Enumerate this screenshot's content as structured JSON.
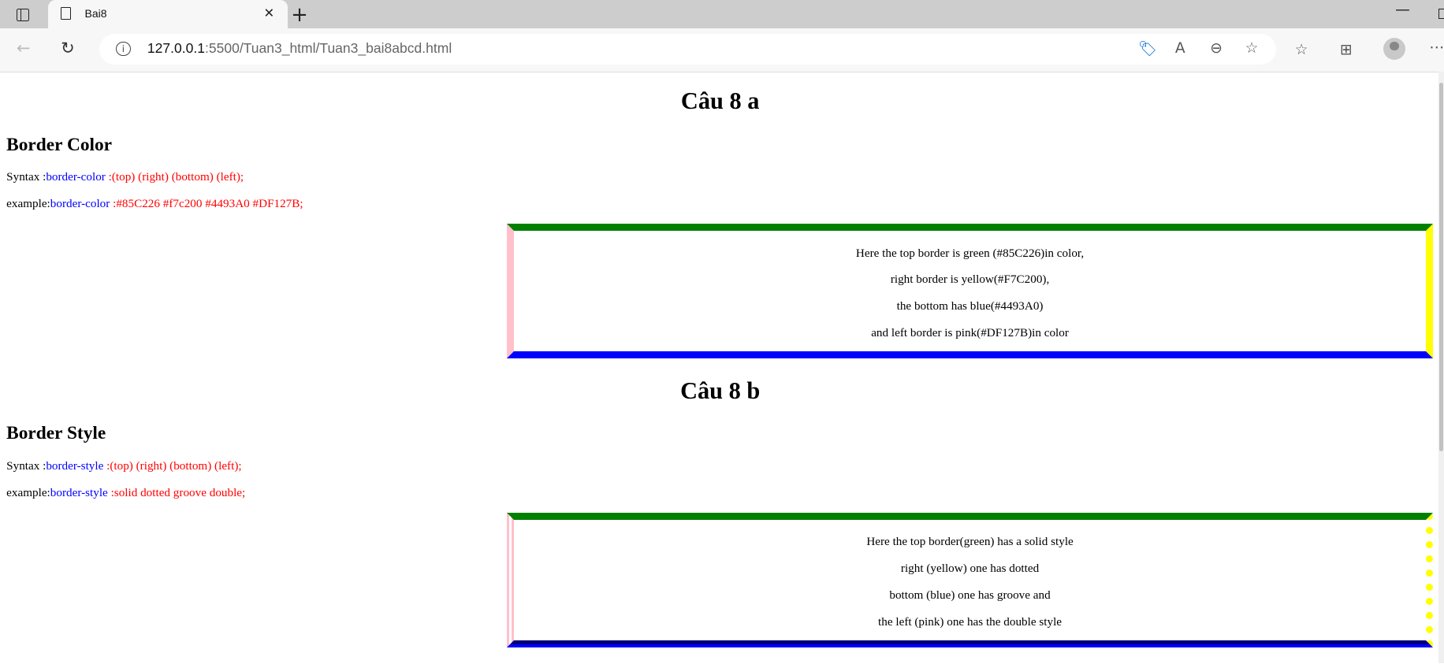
{
  "browser": {
    "tab_title": "Bai8",
    "url_host": "127.0.0.1",
    "url_rest": ":5500/Tuan3_html/Tuan3_bai8abcd.html"
  },
  "section_a": {
    "title": "Câu 8 a",
    "heading": "Border Color",
    "syntax": {
      "label": "Syntax :",
      "prop": "border-color",
      "value": " :(top) (right) (bottom) (left);"
    },
    "example": {
      "label": "example:",
      "prop": "border-color",
      "value": " :#85C226 #f7c200 #4493A0 #DF127B;"
    },
    "lines": [
      "Here the top border is green (#85C226)in color,",
      "right border is yellow(#F7C200),",
      "the bottom has blue(#4493A0)",
      "and left border is pink(#DF127B)in color"
    ]
  },
  "section_b": {
    "title": "Câu 8 b",
    "heading": "Border Style",
    "syntax": {
      "label": "Syntax :",
      "prop": "border-style",
      "value": " :(top) (right) (bottom) (left);"
    },
    "example": {
      "label": "example:",
      "prop": "border-style",
      "value": " :solid dotted groove double;"
    },
    "lines": [
      "Here the top border(green) has a solid style",
      "right (yellow) one has dotted",
      "bottom (blue) one has groove and",
      "the left (pink) one has the double style"
    ]
  }
}
